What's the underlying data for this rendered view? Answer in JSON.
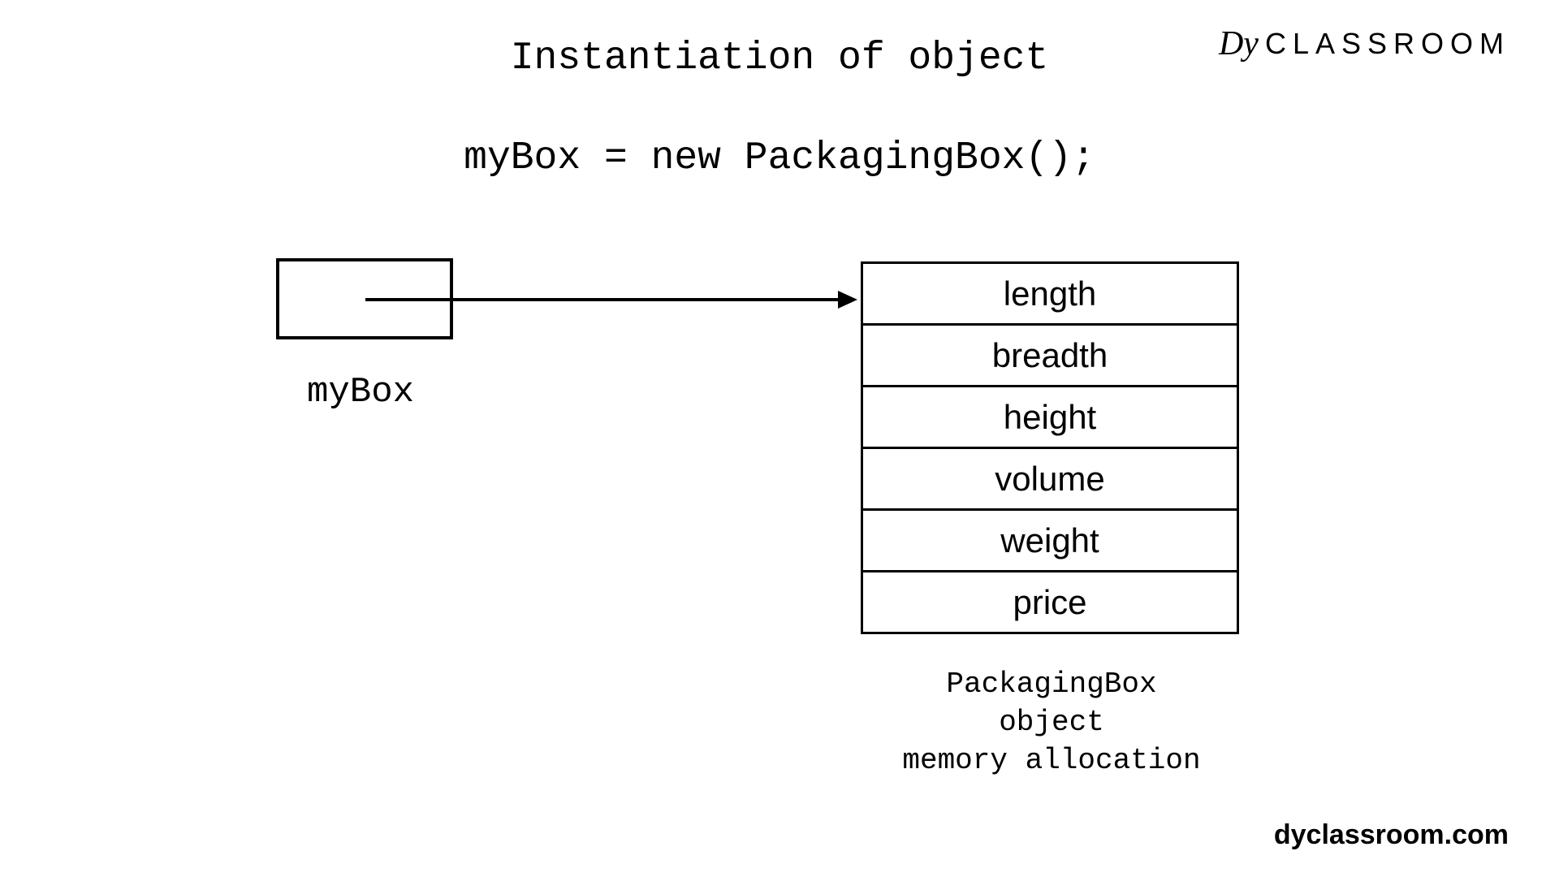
{
  "title": "Instantiation of object",
  "code": "myBox = new PackagingBox();",
  "brand": {
    "glyph": "Dy",
    "text": "CLASSROOM"
  },
  "reference": {
    "label": "myBox"
  },
  "object": {
    "fields": [
      "length",
      "breadth",
      "height",
      "volume",
      "weight",
      "price"
    ],
    "caption_line1": "PackagingBox object",
    "caption_line2": "memory allocation"
  },
  "footer": {
    "url": "dyclassroom.com"
  }
}
